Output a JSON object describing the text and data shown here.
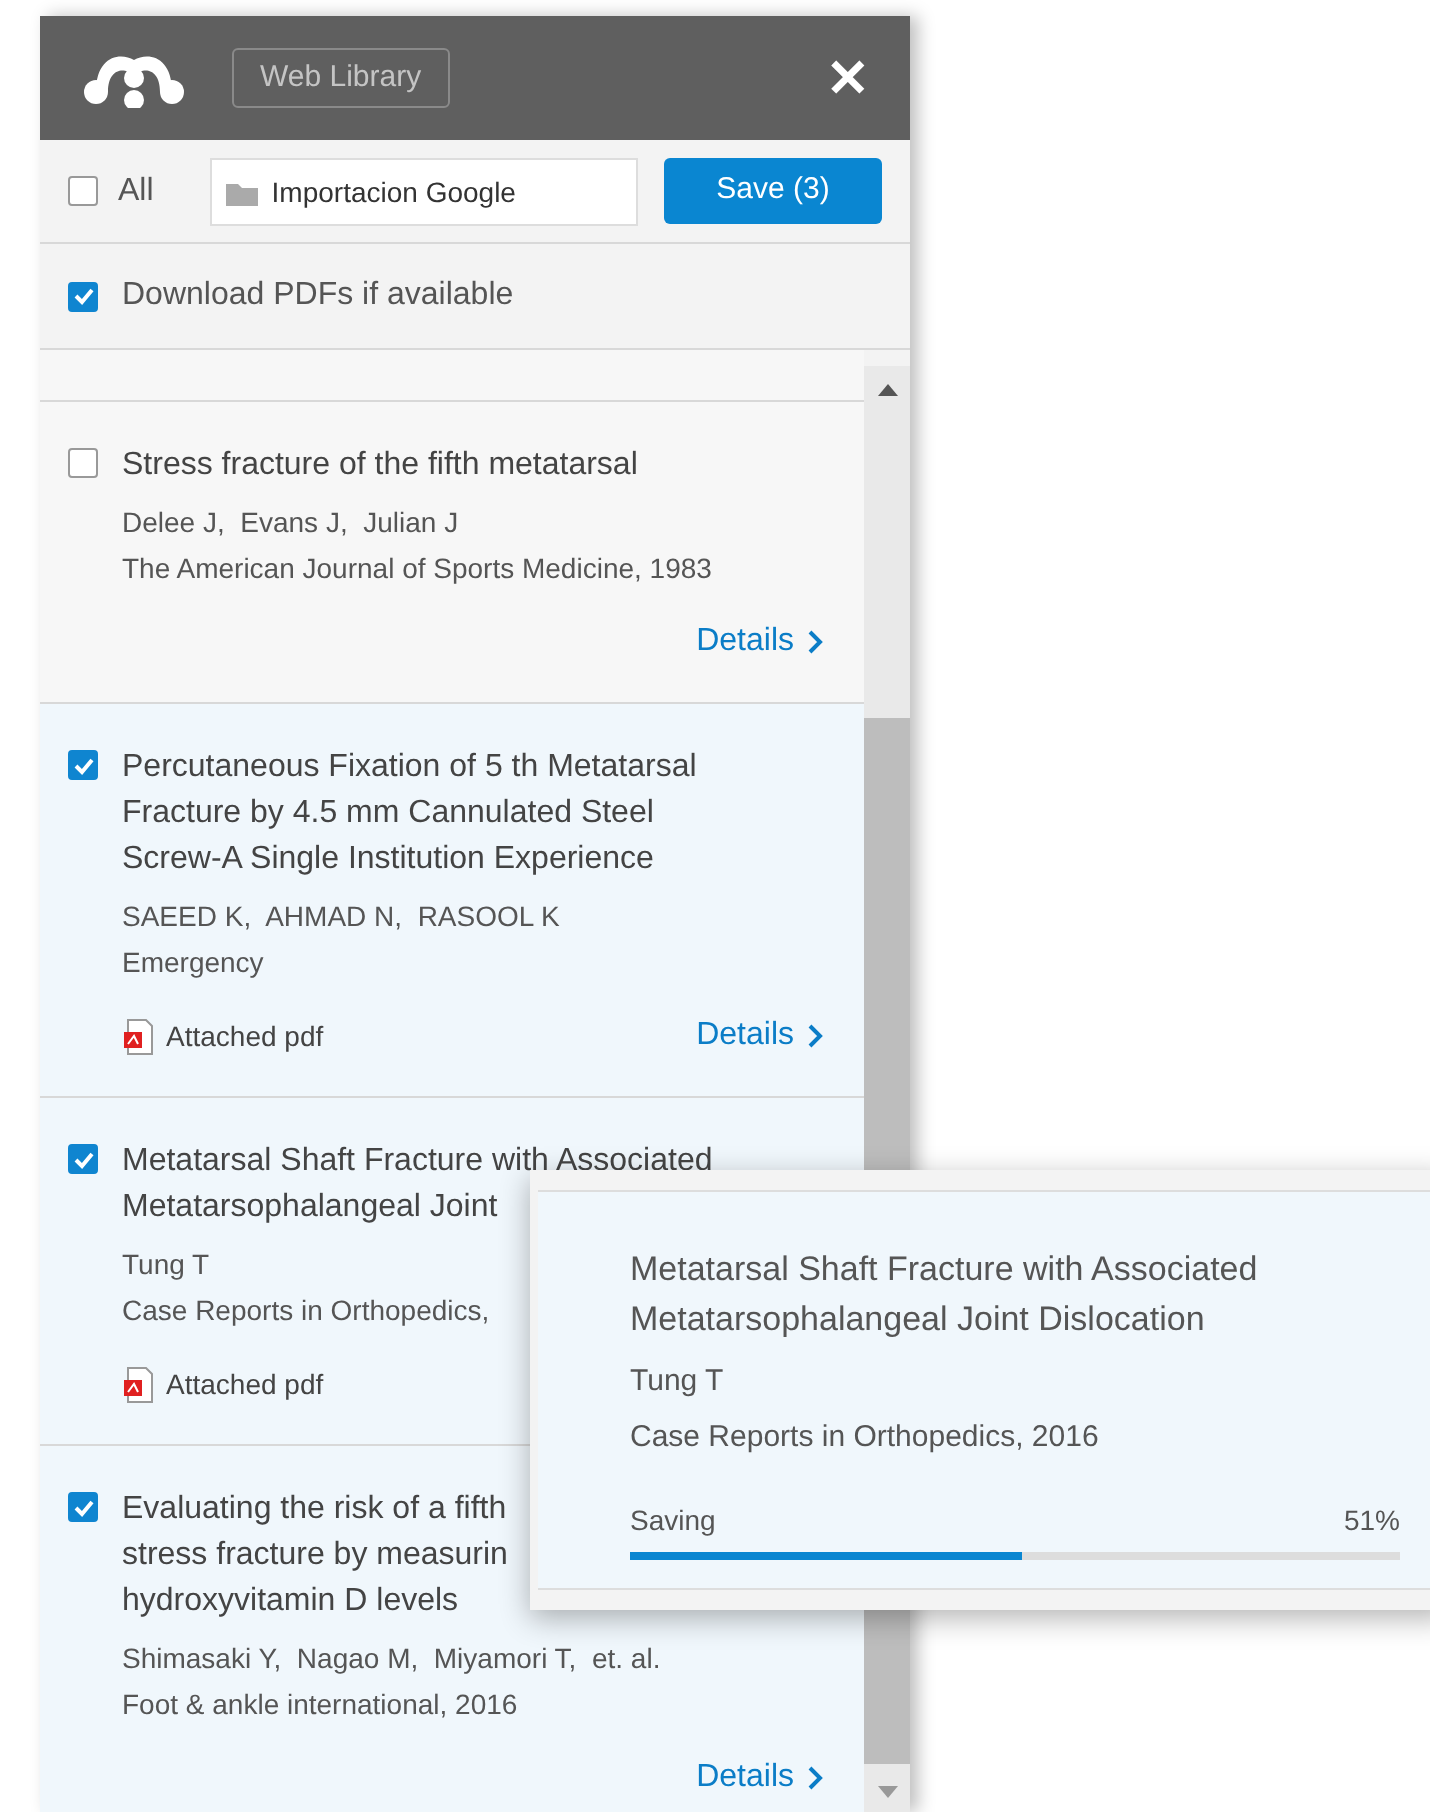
{
  "header": {
    "library_button": "Web Library",
    "close": "✕"
  },
  "toolbar": {
    "select_all": {
      "label": "All",
      "checked": false
    },
    "folder_field": {
      "value": "Importacion Google"
    },
    "save_button": "Save (3)"
  },
  "download_pdfs": {
    "label": "Download PDFs if available",
    "checked": true
  },
  "items": [
    {
      "checked": false,
      "title_lines": [
        "Stress fracture of the fifth metatarsal"
      ],
      "authors": "Delee J,  Evans J,  Julian J",
      "source": "The American Journal of Sports Medicine, 1983",
      "details": "Details"
    },
    {
      "checked": true,
      "title_lines": [
        "Percutaneous Fixation of 5 th Metatarsal",
        "Fracture by 4.5 mm Cannulated Steel",
        "Screw-A Single Institution Experience"
      ],
      "authors": "SAEED K,  AHMAD N,  RASOOL K",
      "source": "Emergency",
      "attachment": "Attached pdf",
      "details": "Details"
    },
    {
      "checked": true,
      "title_lines": [
        "Metatarsal Shaft Fracture with Associated",
        "Metatarsophalangeal Joint"
      ],
      "authors": "Tung T",
      "source": "Case Reports in Orthopedics,",
      "attachment": "Attached pdf"
    },
    {
      "checked": true,
      "title_lines": [
        "Evaluating the risk of a fifth",
        "stress fracture by measurin",
        "hydroxyvitamin D levels"
      ],
      "authors": "Shimasaki Y,  Nagao M,  Miyamori T,  et. al.",
      "source": "Foot & ankle international, 2016",
      "details": "Details"
    }
  ],
  "saving_popup": {
    "title_lines": [
      "Metatarsal Shaft Fracture with Associated",
      "Metatarsophalangeal Joint Dislocation"
    ],
    "authors": "Tung T",
    "source": "Case Reports in Orthopedics, 2016",
    "status": "Saving",
    "percent": "51%",
    "level": 0.51
  }
}
